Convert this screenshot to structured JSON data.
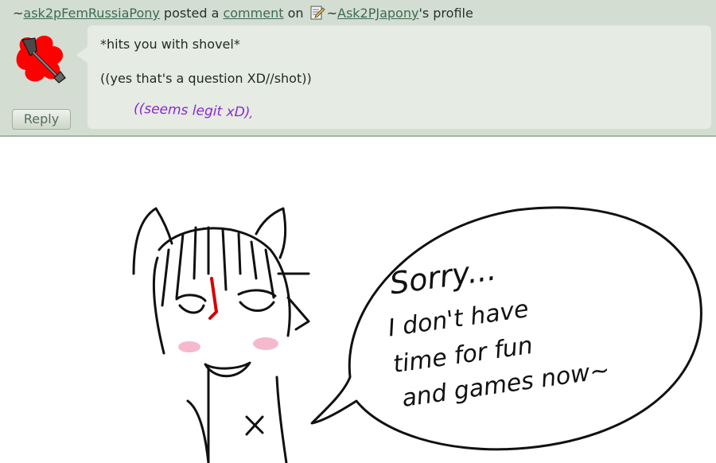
{
  "comment": {
    "prefix": "~",
    "author": "ask2pFemRussiaPony",
    "posted_text": " posted a ",
    "comment_link": "comment",
    "on_text": " on ",
    "profile_prefix": "~",
    "profile_user": "Ask2PJapony",
    "profile_suffix": "'s profile",
    "line1": "*hits you with shovel*",
    "line2": "((yes that's a question XD//shot))",
    "handwritten": "((seems legit xD))",
    "reply_label": "Reply"
  },
  "colors": {
    "panel_bg": "#d4ddd2",
    "bubble_bg": "#e6ebe3",
    "link": "#3c6b52",
    "avatar_red": "#ff0000",
    "handwriting": "#8a2bd1"
  },
  "speech": {
    "line1": "Sorry...",
    "line2": "I don't have",
    "line3": "time for fun",
    "line4": "and games now~"
  },
  "icons": [
    "document-edit-icon",
    "shovel-avatar-icon"
  ]
}
